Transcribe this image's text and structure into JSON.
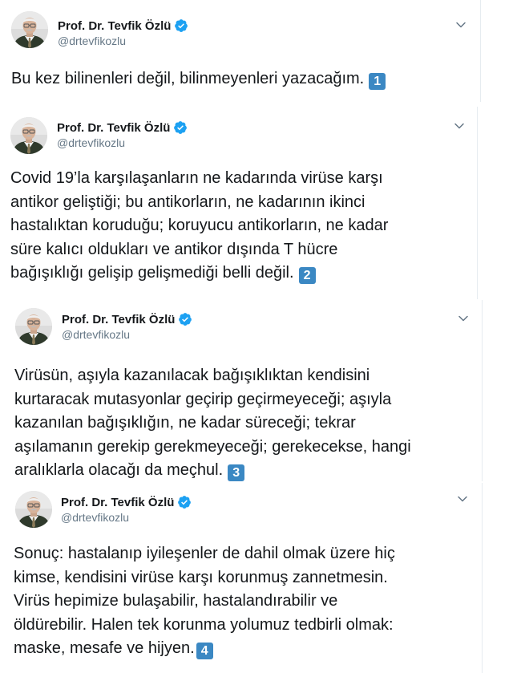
{
  "author": {
    "name": "Prof. Dr. Tevfik Özlü",
    "handle": "@drtevfikozlu",
    "verified": true,
    "avatar_icon": "avatar-photo"
  },
  "colors": {
    "badge": "#3b88c3",
    "verified": "#1da1f2",
    "handle": "#657786",
    "text": "#14171a"
  },
  "tweets": [
    {
      "text": "Bu kez bilinenleri değil, bilinmeyenleri yazacağım.",
      "number": "1"
    },
    {
      "text": "Covid 19’la karşılaşanların ne kadarında virüse karşı\nantikor geliştiği; bu antikorların, ne kadarının ikinci\nhastalıktan koruduğu; koruyucu antikorların, ne kadar\nsüre kalıcı oldukları ve antikor dışında T hücre\nbağışıklığı gelişip gelişmediği belli değil.",
      "number": "2"
    },
    {
      "text": "Virüsün, aşıyla kazanılacak bağışıklıktan kendisini\nkurtaracak mutasyonlar geçirip geçirmeyeceği; aşıyla\nkazanılan bağışıklığın, ne kadar süreceği; tekrar\naşılamanın gerekip gerekmeyeceği; gerekecekse, hangi\naralıklarla olacağı da meçhul.",
      "number": "3"
    },
    {
      "text": "Sonuç: hastalanıp iyileşenler de dahil olmak üzere hiç\nkimse, kendisini virüse karşı korunmuş zannetmesin.\nVirüs  hepimize bulaşabilir, hastalandırabilir ve\nöldürebilir. Halen tek korunma yolumuz tedbirli olmak:\nmaske, mesafe ve hijyen.",
      "number": "4"
    }
  ]
}
